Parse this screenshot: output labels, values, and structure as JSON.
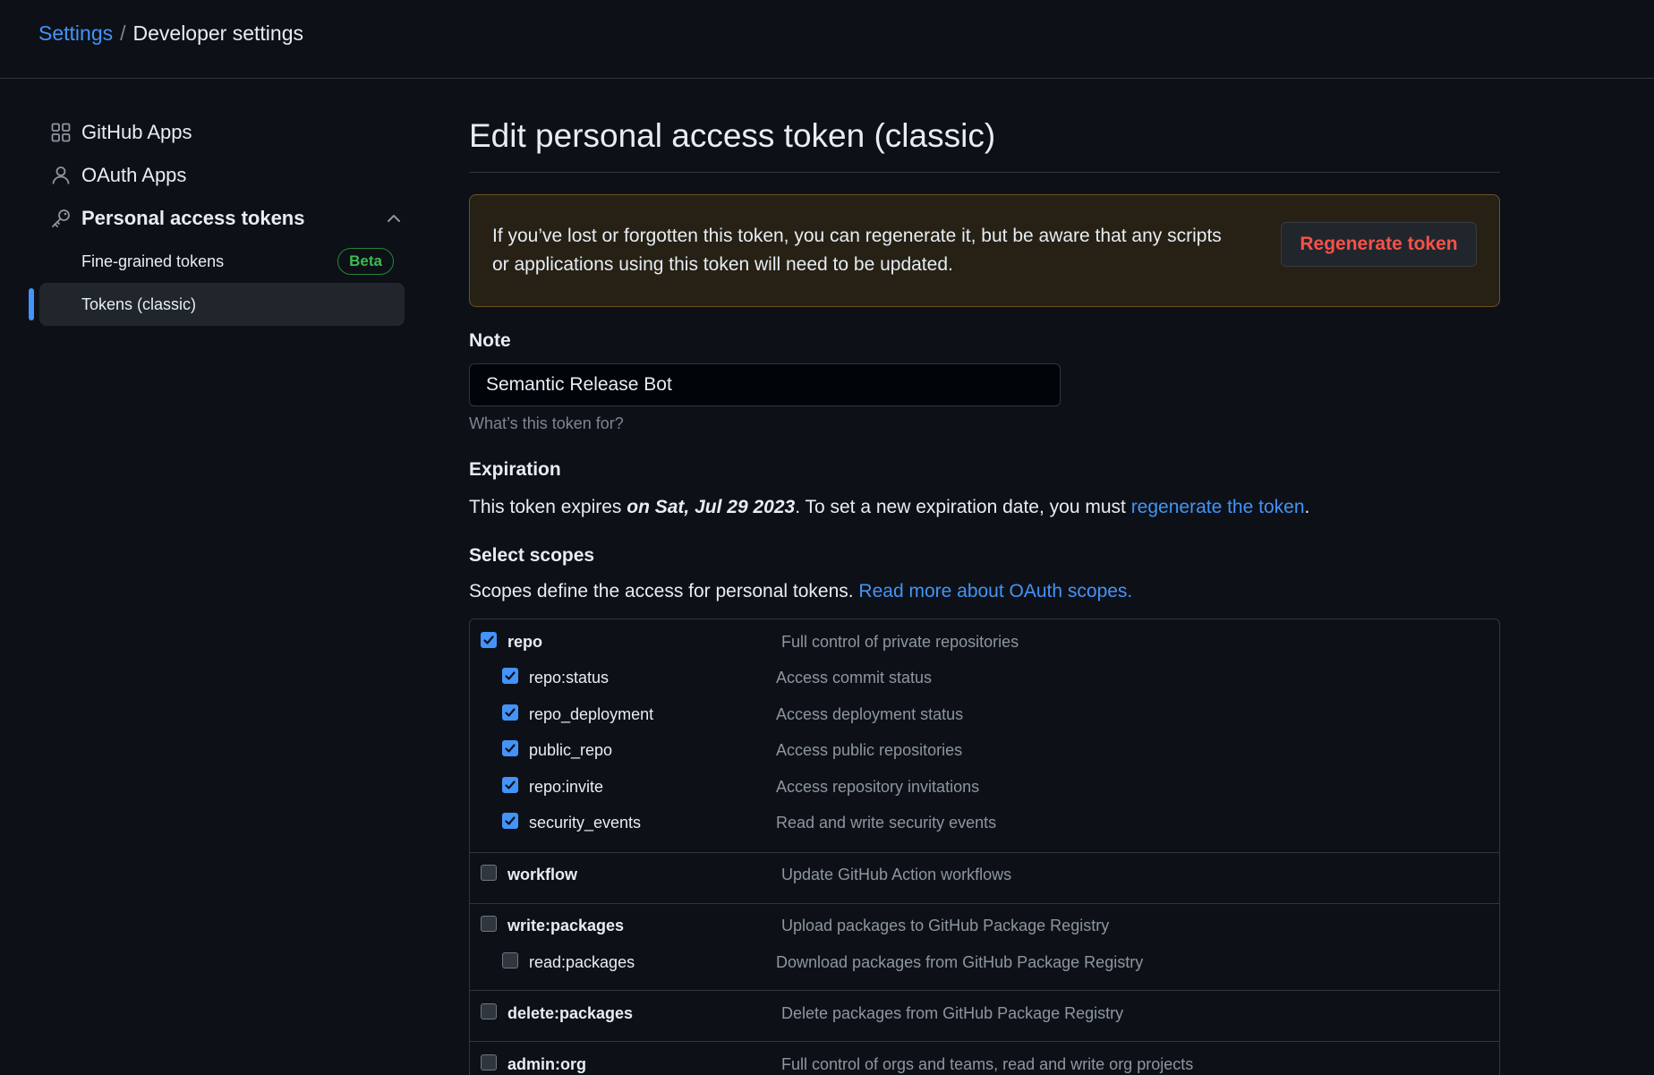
{
  "breadcrumb": {
    "parent": "Settings",
    "separator": "/",
    "current": "Developer settings"
  },
  "sidebar": {
    "items": [
      {
        "label": "GitHub Apps",
        "icon": "apps-icon"
      },
      {
        "label": "OAuth Apps",
        "icon": "person-icon"
      },
      {
        "label": "Personal access tokens",
        "icon": "key-icon"
      }
    ],
    "subitems": [
      {
        "label": "Fine-grained tokens",
        "badge": "Beta"
      },
      {
        "label": "Tokens (classic)"
      }
    ]
  },
  "main": {
    "title": "Edit personal access token (classic)",
    "flash": {
      "message": "If you’ve lost or forgotten this token, you can regenerate it, but be aware that any scripts or applications using this token will need to be updated.",
      "button": "Regenerate token"
    },
    "note": {
      "label": "Note",
      "value": "Semantic Release Bot",
      "hint": "What’s this token for?"
    },
    "expiration": {
      "label": "Expiration",
      "prefix": "This token expires ",
      "date": "on Sat, Jul 29 2023",
      "middle": ". To set a new expiration date, you must ",
      "link": "regenerate the token",
      "suffix": "."
    },
    "scopes": {
      "label": "Select scopes",
      "intro": "Scopes define the access for personal tokens. ",
      "link": "Read more about OAuth scopes.",
      "rows": [
        {
          "name": "repo",
          "desc": "Full control of private repositories",
          "checked": true
        },
        {
          "name": "repo:status",
          "desc": "Access commit status",
          "checked": true
        },
        {
          "name": "repo_deployment",
          "desc": "Access deployment status",
          "checked": true
        },
        {
          "name": "public_repo",
          "desc": "Access public repositories",
          "checked": true
        },
        {
          "name": "repo:invite",
          "desc": "Access repository invitations",
          "checked": true
        },
        {
          "name": "security_events",
          "desc": "Read and write security events",
          "checked": true
        },
        {
          "name": "workflow",
          "desc": "Update GitHub Action workflows",
          "checked": false
        },
        {
          "name": "write:packages",
          "desc": "Upload packages to GitHub Package Registry",
          "checked": false
        },
        {
          "name": "read:packages",
          "desc": "Download packages from GitHub Package Registry",
          "checked": false
        },
        {
          "name": "delete:packages",
          "desc": "Delete packages from GitHub Package Registry",
          "checked": false
        },
        {
          "name": "admin:org",
          "desc": "Full control of orgs and teams, read and write org projects",
          "checked": false
        }
      ]
    }
  },
  "colors": {
    "accent": "#4493f8",
    "danger": "#f85149",
    "success": "#3fb950",
    "warning_bg": "#272115"
  }
}
